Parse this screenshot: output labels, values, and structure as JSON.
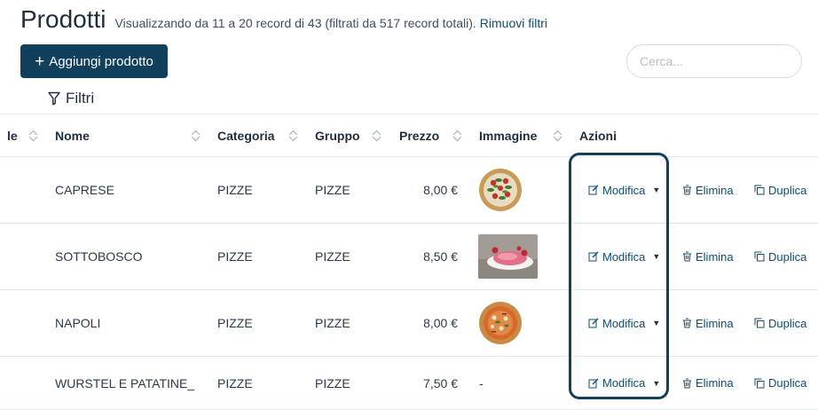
{
  "header": {
    "title": "Prodotti",
    "subtitle": "Visualizzando da 11 a 20 record di 43 (filtrati da 517 record totali).",
    "remove_filters": "Rimuovi filtri"
  },
  "toolbar": {
    "add_icon": "+",
    "add_label": "Aggiungi prodotto",
    "search_placeholder": "Cerca...",
    "filters_label": "Filtri"
  },
  "table": {
    "columns": {
      "partial": "le",
      "name": "Nome",
      "category": "Categoria",
      "group": "Gruppo",
      "price": "Prezzo",
      "image": "Immagine",
      "actions": "Azioni"
    },
    "rows": [
      {
        "name": "CAPRESE",
        "category": "PIZZE",
        "group": "PIZZE",
        "price": "8,00 €",
        "image": "pizza-caprese"
      },
      {
        "name": "SOTTOBOSCO",
        "category": "PIZZE",
        "group": "PIZZE",
        "price": "8,50 €",
        "image": "pizza-sottobosco"
      },
      {
        "name": "NAPOLI",
        "category": "PIZZE",
        "group": "PIZZE",
        "price": "8,00 €",
        "image": "pizza-napoli"
      },
      {
        "name": "WURSTEL E PATATINE_",
        "category": "PIZZE",
        "group": "PIZZE",
        "price": "7,50 €",
        "image_placeholder": "-"
      }
    ],
    "actions": {
      "edit": "Modifica",
      "delete": "Elimina",
      "duplicate": "Duplica"
    }
  },
  "colors": {
    "primary": "#11405c",
    "link": "#0f4c6e",
    "border": "#e3e7eb"
  }
}
